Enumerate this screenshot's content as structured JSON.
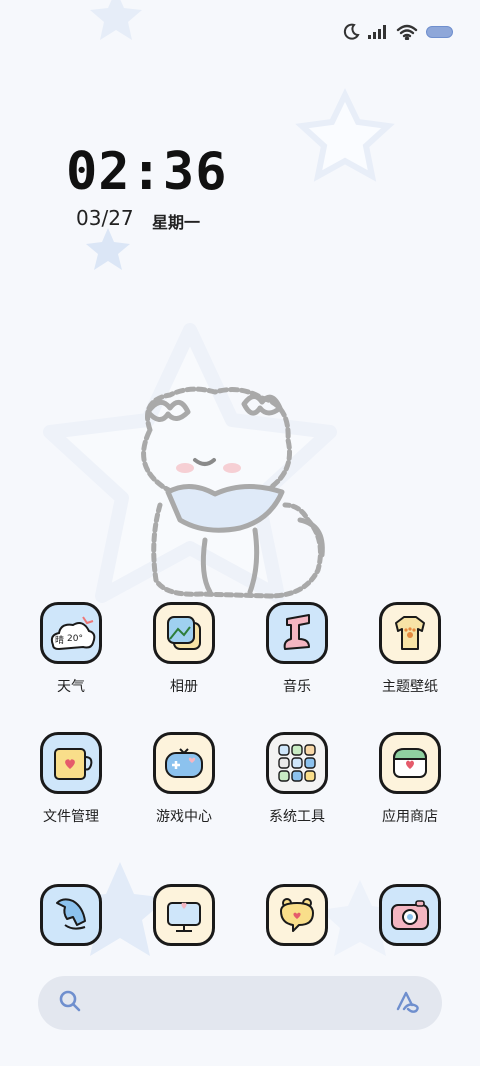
{
  "status": {
    "icons": [
      "moon-icon",
      "signal-icon",
      "wifi-icon",
      "battery-icon"
    ],
    "accent": "#6f8fce"
  },
  "clock": {
    "time": "02:36",
    "date": "03/27",
    "weekday": "星期一"
  },
  "weather_widget": {
    "condition": "晴",
    "temp": "20°"
  },
  "apps": [
    {
      "label": "天气",
      "icon": "weather-icon"
    },
    {
      "label": "相册",
      "icon": "gallery-icon"
    },
    {
      "label": "音乐",
      "icon": "music-icon"
    },
    {
      "label": "主题壁纸",
      "icon": "theme-wallpaper-icon"
    },
    {
      "label": "文件管理",
      "icon": "file-manager-icon"
    },
    {
      "label": "游戏中心",
      "icon": "game-center-icon"
    },
    {
      "label": "系统工具",
      "icon": "system-tools-icon"
    },
    {
      "label": "应用商店",
      "icon": "app-store-icon"
    }
  ],
  "dock": [
    {
      "icon": "phone-icon"
    },
    {
      "icon": "browser-icon"
    },
    {
      "icon": "messages-icon"
    },
    {
      "icon": "camera-icon"
    }
  ],
  "search": {
    "icon": "search-icon",
    "assistant_icon": "assistant-icon"
  },
  "colors": {
    "background": "#f6f8fc",
    "icon_blue": "#cfe6fa",
    "icon_cream": "#fdf3dc",
    "icon_pink": "#f4b6c2",
    "outline": "#1a1a1a"
  }
}
